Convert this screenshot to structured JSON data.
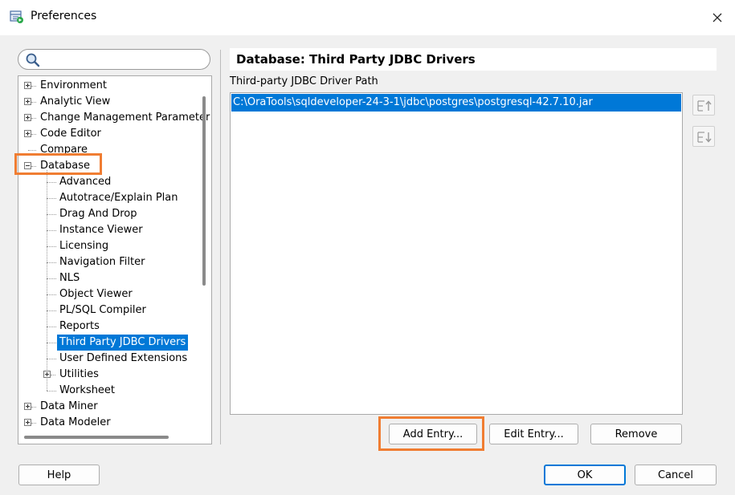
{
  "window": {
    "title": "Preferences"
  },
  "search": {
    "placeholder": "",
    "value": ""
  },
  "tree": {
    "items": [
      {
        "label": "Environment",
        "level": 0,
        "expander": "plus"
      },
      {
        "label": "Analytic View",
        "level": 0,
        "expander": "plus"
      },
      {
        "label": "Change Management Parameter",
        "level": 0,
        "expander": "plus"
      },
      {
        "label": "Code Editor",
        "level": 0,
        "expander": "plus"
      },
      {
        "label": "Compare",
        "level": 0,
        "expander": "none"
      },
      {
        "label": "Database",
        "level": 0,
        "expander": "minus"
      },
      {
        "label": "Advanced",
        "level": 1,
        "expander": "none"
      },
      {
        "label": "Autotrace/Explain Plan",
        "level": 1,
        "expander": "none"
      },
      {
        "label": "Drag And Drop",
        "level": 1,
        "expander": "none"
      },
      {
        "label": "Instance Viewer",
        "level": 1,
        "expander": "none"
      },
      {
        "label": "Licensing",
        "level": 1,
        "expander": "none"
      },
      {
        "label": "Navigation Filter",
        "level": 1,
        "expander": "none"
      },
      {
        "label": "NLS",
        "level": 1,
        "expander": "none"
      },
      {
        "label": "Object Viewer",
        "level": 1,
        "expander": "none"
      },
      {
        "label": "PL/SQL Compiler",
        "level": 1,
        "expander": "none"
      },
      {
        "label": "Reports",
        "level": 1,
        "expander": "none"
      },
      {
        "label": "Third Party JDBC Drivers",
        "level": 1,
        "expander": "none",
        "selected": true
      },
      {
        "label": "User Defined Extensions",
        "level": 1,
        "expander": "none"
      },
      {
        "label": "Utilities",
        "level": 1,
        "expander": "plus"
      },
      {
        "label": "Worksheet",
        "level": 1,
        "expander": "none"
      },
      {
        "label": "Data Miner",
        "level": 0,
        "expander": "plus"
      },
      {
        "label": "Data Modeler",
        "level": 0,
        "expander": "plus"
      }
    ]
  },
  "main": {
    "page_title": "Database: Third Party JDBC Drivers",
    "path_label": "Third-party JDBC Driver Path",
    "entries": [
      "C:\\OraTools\\sqldeveloper-24-3-1\\jdbc\\postgres\\postgresql-42.7.10.jar"
    ],
    "move_up_icon": "move-up-icon",
    "move_down_icon": "move-down-icon",
    "add_label": "Add Entry...",
    "edit_label": "Edit Entry...",
    "remove_label": "Remove"
  },
  "footer": {
    "help_label": "Help",
    "ok_label": "OK",
    "cancel_label": "Cancel"
  },
  "colors": {
    "selection": "#0078d7",
    "highlight": "#f07d32",
    "background": "#f0f0f0"
  }
}
